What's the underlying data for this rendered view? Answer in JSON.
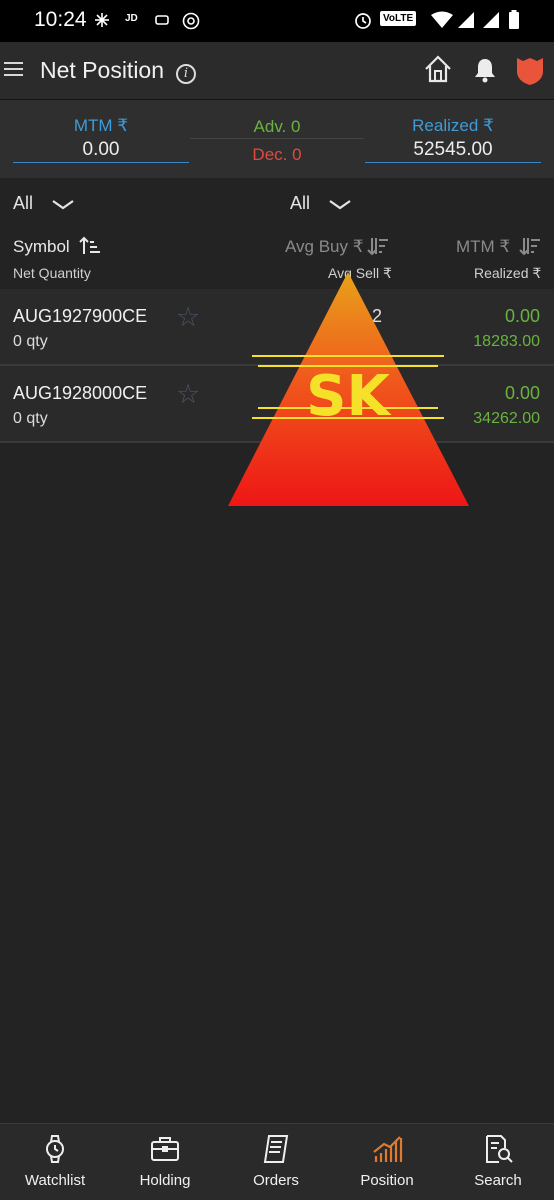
{
  "status_bar": {
    "time": "10:24",
    "volte": "VoLTE"
  },
  "header": {
    "title": "Net Position",
    "icons": [
      "menu-icon",
      "info-icon",
      "home-icon",
      "bell-icon",
      "shield-icon"
    ]
  },
  "summary": {
    "mtm_label": "MTM ₹",
    "mtm_value": "0.00",
    "adv_label": "Adv. 0",
    "dec_label": "Dec. 0",
    "realized_label": "Realized ₹",
    "realized_value": "52545.00"
  },
  "filters": {
    "left_value": "All",
    "right_value": "All"
  },
  "columns": {
    "symbol": "Symbol",
    "net_quantity": "Net Quantity",
    "avg_buy": "Avg Buy ₹",
    "avg_sell": "Avg Sell ₹",
    "mtm": "MTM ₹",
    "realized": "Realized ₹"
  },
  "rows": [
    {
      "symbol": "AUG1927900CE",
      "qty": "0 qty",
      "avg": "2",
      "mtm": "0.00",
      "realized": "18283.00"
    },
    {
      "symbol": "AUG1928000CE",
      "qty": "0 qty",
      "avg": "",
      "mtm": "0.00",
      "realized": "34262.00"
    }
  ],
  "watermark": {
    "text": "SK"
  },
  "bottom_nav": {
    "items": [
      {
        "label": "Watchlist",
        "icon": "watch-icon"
      },
      {
        "label": "Holding",
        "icon": "briefcase-icon"
      },
      {
        "label": "Orders",
        "icon": "orders-icon"
      },
      {
        "label": "Position",
        "icon": "position-chart-icon"
      },
      {
        "label": "Search",
        "icon": "search-doc-icon"
      }
    ],
    "active_index": 3
  },
  "colors": {
    "accent_blue": "#3f9bd6",
    "profit_green": "#6ab340",
    "loss_red": "#e04b3e",
    "active_orange": "#e07a2e"
  }
}
